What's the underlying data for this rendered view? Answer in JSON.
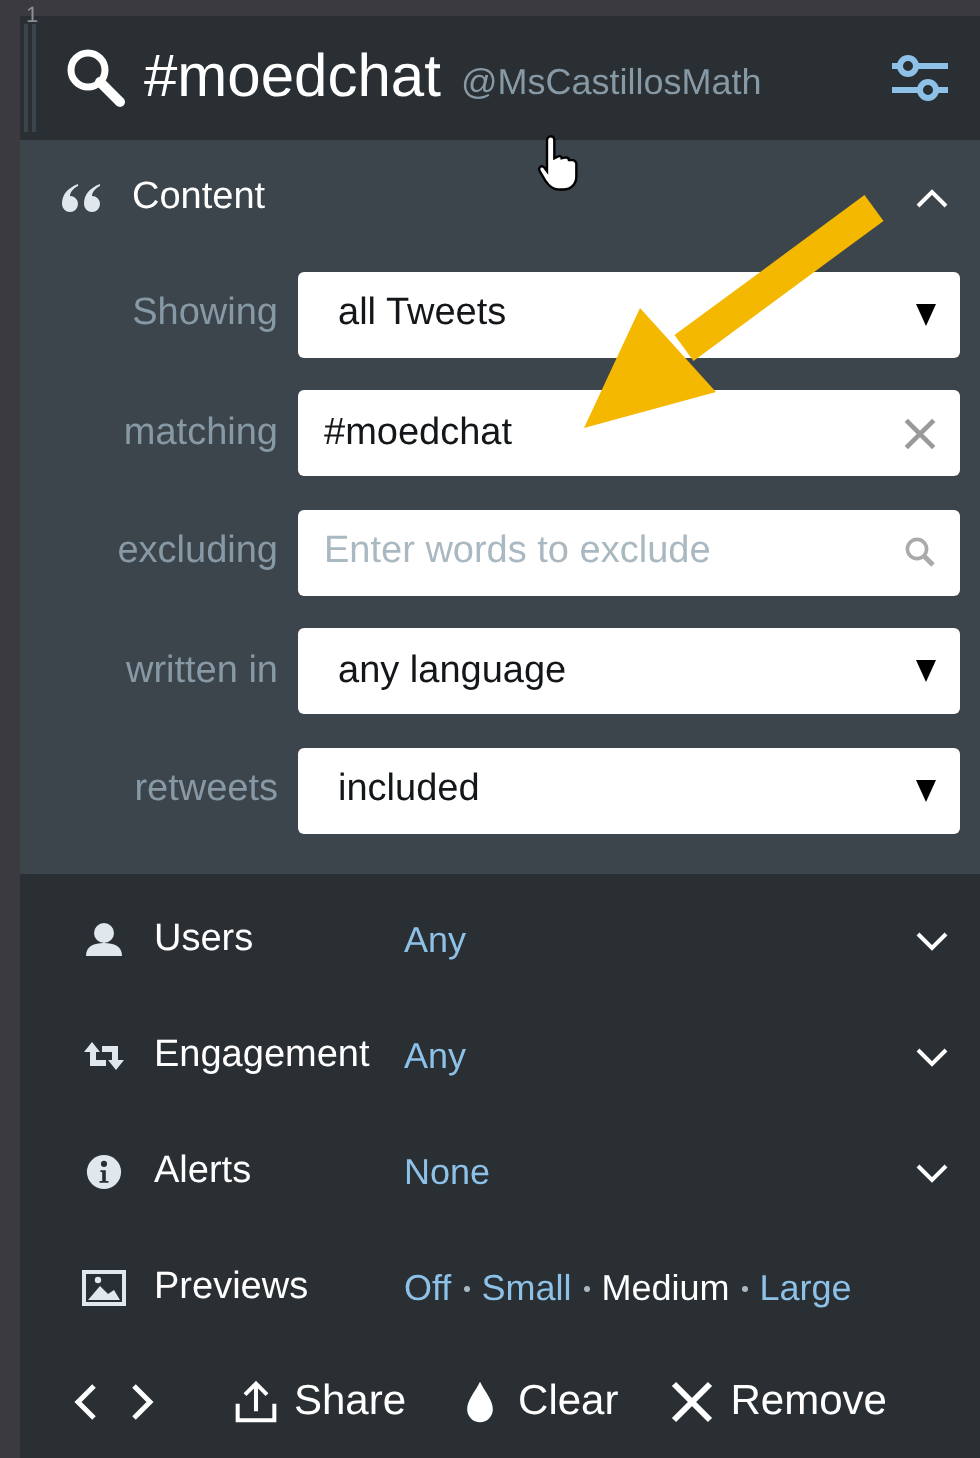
{
  "column_number": "1",
  "header": {
    "title": "#moedchat",
    "account": "@MsCastillosMath"
  },
  "content": {
    "label": "Content",
    "expanded": true,
    "filters": [
      {
        "label": "Showing",
        "kind": "select",
        "value": "all Tweets"
      },
      {
        "label": "matching",
        "kind": "text",
        "value": "#moedchat"
      },
      {
        "label": "excluding",
        "kind": "search",
        "placeholder": "Enter words to exclude"
      },
      {
        "label": "written in",
        "kind": "select",
        "value": "any language"
      },
      {
        "label": "retweets",
        "kind": "select",
        "value": "included"
      }
    ]
  },
  "sections": [
    {
      "kind": "users",
      "label": "Users",
      "value": "Any",
      "expanded": false
    },
    {
      "kind": "engagement",
      "label": "Engagement",
      "value": "Any",
      "expanded": false
    },
    {
      "kind": "alerts",
      "label": "Alerts",
      "value": "None",
      "expanded": false
    }
  ],
  "previews": {
    "label": "Previews",
    "options": [
      {
        "label": "Off",
        "selected": false
      },
      {
        "label": "Small",
        "selected": false
      },
      {
        "label": "Medium",
        "selected": true
      },
      {
        "label": "Large",
        "selected": false
      }
    ]
  },
  "footer": {
    "buttons": [
      {
        "kind": "share",
        "label": "Share"
      },
      {
        "kind": "clear",
        "label": "Clear"
      },
      {
        "kind": "remove",
        "label": "Remove"
      }
    ]
  }
}
